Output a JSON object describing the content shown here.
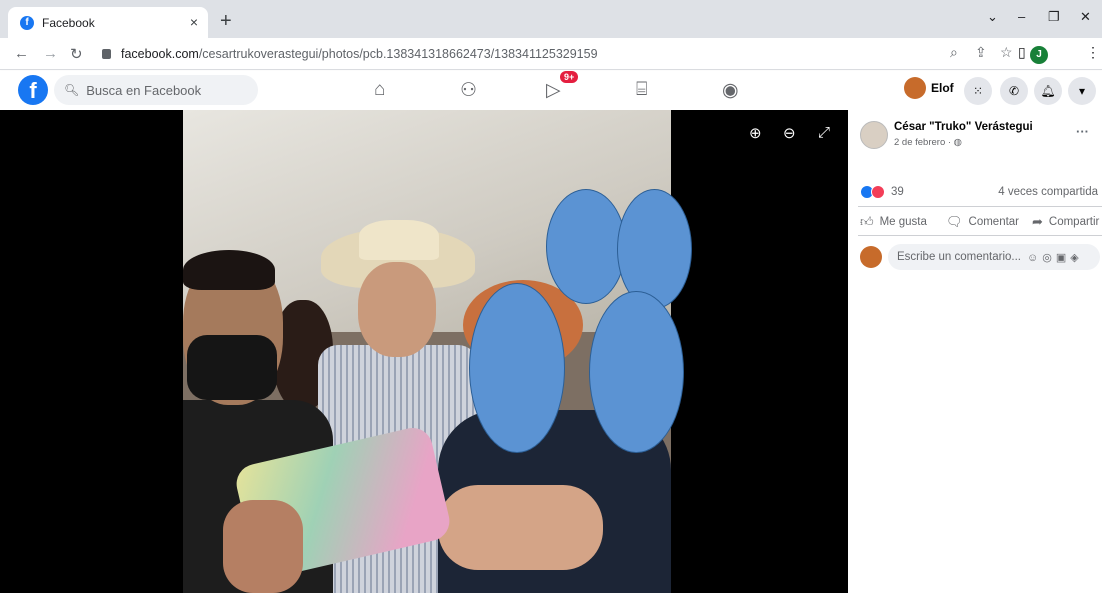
{
  "browser": {
    "tab_title": "Facebook",
    "tab_close": "×",
    "new_tab": "+",
    "url_domain": "facebook.com",
    "url_path": "/cesartrukoverastegui/photos/pcb.138341318662473/138341125329159",
    "profile_initial": "J"
  },
  "facebook": {
    "logo": "f",
    "search_placeholder": "Busca en Facebook",
    "watch_badge": "9+",
    "user_name": "Elof"
  },
  "post": {
    "author": "César \"Truko\" Verástegui",
    "date": "2 de febrero · ",
    "reaction_count": "39",
    "shares": "4 veces compartida",
    "like_label": "Me gusta",
    "comment_label": "Comentar",
    "share_label": "Compartir",
    "comment_placeholder": "Escribe un comentario..."
  },
  "colors": {
    "brand": "#1877f2",
    "redaction": "#5b93d3",
    "badge": "#e41e3f"
  },
  "icons": [
    "back-icon",
    "forward-icon",
    "reload-icon",
    "lock-icon",
    "zoom-icon",
    "share-icon",
    "star-icon",
    "sidepanel-icon",
    "menu-icon",
    "home-icon",
    "friends-icon",
    "watch-icon",
    "marketplace-icon",
    "groups-icon",
    "apps-icon",
    "messenger-icon",
    "notifications-icon",
    "account-icon",
    "zoom-in-icon",
    "zoom-out-icon",
    "fullscreen-icon",
    "like-icon",
    "comment-icon",
    "share-arrow-icon"
  ]
}
